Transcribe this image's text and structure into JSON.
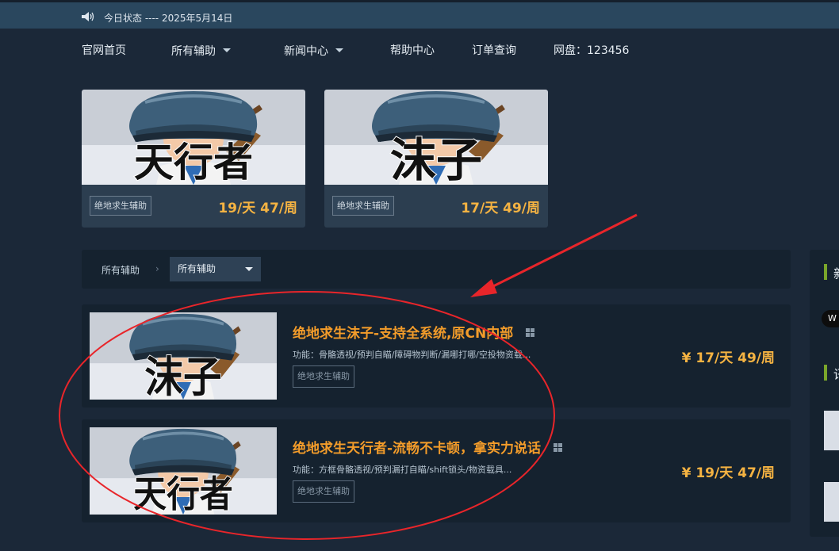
{
  "topbar": {
    "status": "今日状态 ---- 2025年5月14日"
  },
  "nav": {
    "items": [
      {
        "label": "官网首页"
      },
      {
        "label": "所有辅助"
      },
      {
        "label": "新闻中心"
      },
      {
        "label": "帮助中心"
      },
      {
        "label": "订单查询"
      },
      {
        "label": "网盘：123456"
      }
    ]
  },
  "cards": [
    {
      "name": "天行者",
      "tag": "绝地求生辅助",
      "price": "19/天 47/周"
    },
    {
      "name": "沫子",
      "tag": "绝地求生辅助",
      "price": "17/天 49/周"
    }
  ],
  "filter": {
    "breadcrumb": "所有辅助",
    "select_value": "所有辅助"
  },
  "products": [
    {
      "thumb_text": "沫子",
      "title": "绝地求生沫子-支持全系统,原CN内部",
      "desc": "功能：骨骼透视/预判自瞄/障碍物判断/漏哪打哪/空投物资载...",
      "tag": "绝地求生辅助",
      "price": "¥ 17/天 49/周"
    },
    {
      "thumb_text": "天行者",
      "title": "绝地求生天行者-流畅不卡顿，拿实力说话",
      "desc": "功能：方框骨骼透视/预判漏打自瞄/shift锁头/物资载具...",
      "tag": "绝地求生辅助",
      "price": "¥ 19/天 47/周"
    }
  ],
  "sidebar": {
    "heading1": "新",
    "pill": "W",
    "heading2": "讯"
  },
  "colors": {
    "background": "#1b2838",
    "topbar": "#2a475e",
    "price": "#f5b342",
    "title": "#f39c2a",
    "annotation": "#e8252a"
  },
  "icons": {
    "speaker": "speaker-icon",
    "windows": "windows-icon",
    "caret": "caret-down-icon"
  }
}
